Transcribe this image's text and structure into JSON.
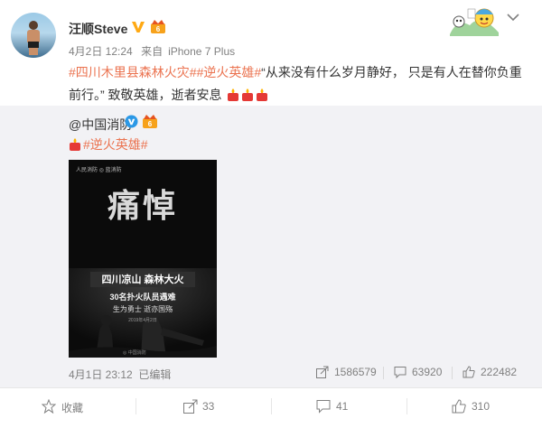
{
  "post": {
    "author": "汪顺Steve",
    "date": "4月2日 12:24",
    "source_prefix": "来自",
    "source": "iPhone 7 Plus",
    "tags": [
      "#四川木里县森林火灾#",
      "#逆火英雄#"
    ],
    "text_quote": "“从来没有什么岁月静好， 只是有人在替你负重前行。” 致敬英雄，逝者安息",
    "emoji_name": "candle-icon"
  },
  "repost": {
    "author": "@中国消防",
    "tag": "#逆火英雄#",
    "poster": {
      "logos": "人民消防  ◎ 蓝消防",
      "headline": "痛悼",
      "line1": "四川凉山  森林大火",
      "line2": "30名扑火队员遇难",
      "line3": "生为勇士   逝亦国殇",
      "line4": "2019年4月2日",
      "footer": "◎ 中国消防"
    },
    "time": "4月1日 23:12",
    "edited": "已编辑",
    "shares": "1586579",
    "comments": "63920",
    "likes": "222482"
  },
  "footer": {
    "favorite": "收藏",
    "share": "33",
    "comment": "41",
    "like": "310"
  },
  "colors": {
    "tag": "#eb7350",
    "meta": "#808080",
    "verified": "#ffa914",
    "repost_bg": "#f2f2f5"
  }
}
